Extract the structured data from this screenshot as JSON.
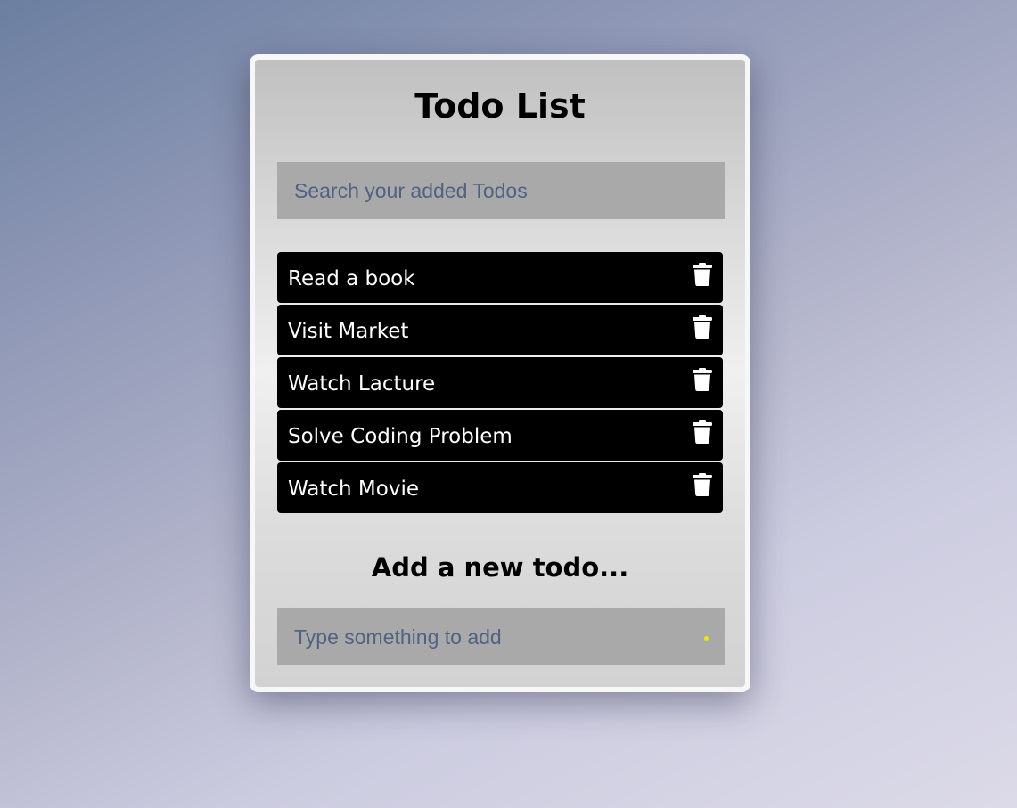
{
  "app": {
    "title": "Todo List"
  },
  "search": {
    "placeholder": "Search your added Todos",
    "value": ""
  },
  "todos": [
    {
      "label": "Read a book",
      "icon": "trash-icon"
    },
    {
      "label": "Visit Market",
      "icon": "trash-icon"
    },
    {
      "label": "Watch Lacture",
      "icon": "trash-icon"
    },
    {
      "label": "Solve Coding Problem",
      "icon": "trash-icon"
    },
    {
      "label": "Watch Movie",
      "icon": "trash-icon"
    }
  ],
  "add": {
    "heading": "Add a new todo...",
    "placeholder": "Type something to add",
    "value": ""
  },
  "colors": {
    "item_background": "#000000",
    "input_background": "#a9a9a9",
    "placeholder": "#4f6383",
    "accent_dot": "#f2e600"
  }
}
